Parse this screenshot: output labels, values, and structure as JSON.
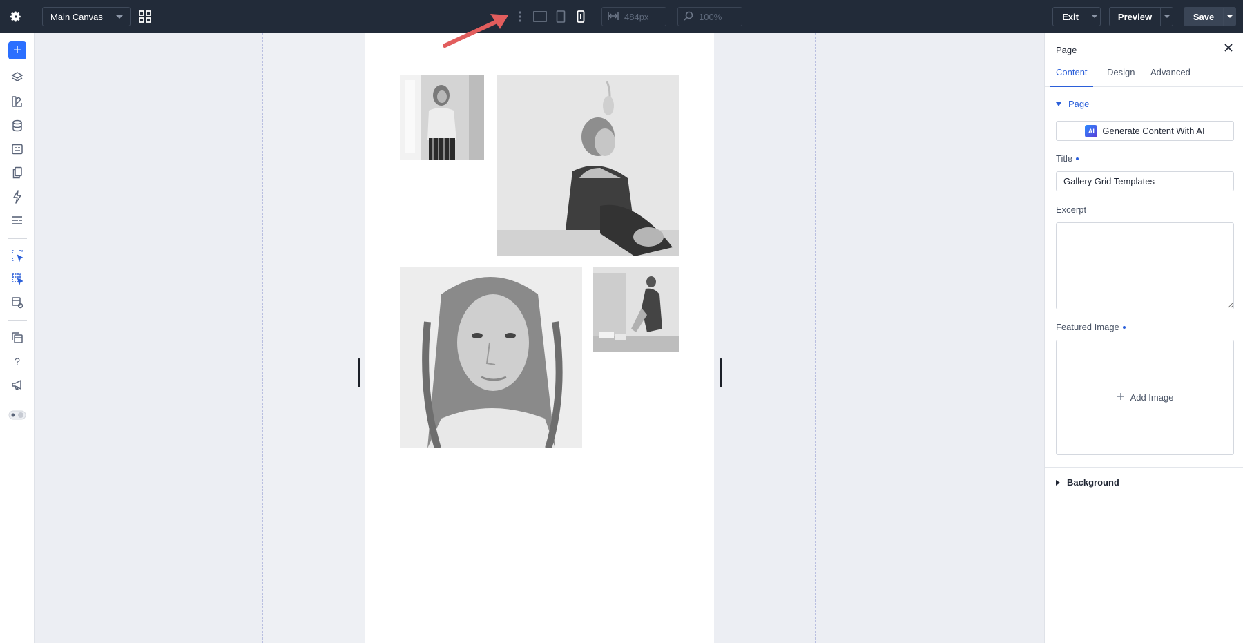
{
  "topbar": {
    "canvas_select": "Main Canvas",
    "width_value": "484px",
    "zoom_value": "100%",
    "exit_label": "Exit",
    "preview_label": "Preview",
    "save_label": "Save",
    "icons": [
      "gear-icon",
      "grid-view-icon",
      "more-vertical-icon",
      "desktop-icon",
      "tablet-icon",
      "mobile-icon",
      "width-icon",
      "zoom-icon"
    ]
  },
  "leftbar": {
    "icons": [
      "add-icon",
      "layers-icon",
      "palette-icon",
      "database-icon",
      "forms-icon",
      "pages-icon",
      "lightning-icon",
      "list-icon",
      "select-target-icon",
      "multi-select-icon",
      "template-icon",
      "stack-icon",
      "help-icon",
      "megaphone-icon",
      "theme-toggle-icon"
    ]
  },
  "canvas": {
    "photos": [
      "photo-window",
      "photo-seated",
      "photo-portrait",
      "photo-studio"
    ]
  },
  "panel": {
    "title": "Page",
    "tabs": [
      "Content",
      "Design",
      "Advanced"
    ],
    "active_tab": "Content",
    "section_page": "Page",
    "ai_button": "Generate Content With AI",
    "ai_badge": "AI",
    "title_label": "Title",
    "title_value": "Gallery Grid Templates",
    "excerpt_label": "Excerpt",
    "featured_label": "Featured Image",
    "add_image": "Add Image",
    "section_background": "Background"
  },
  "colors": {
    "topbar": "#222b39",
    "accent": "#2b5fd9",
    "add_button": "#2b6fff",
    "annotation_arrow": "#e25d5d"
  }
}
